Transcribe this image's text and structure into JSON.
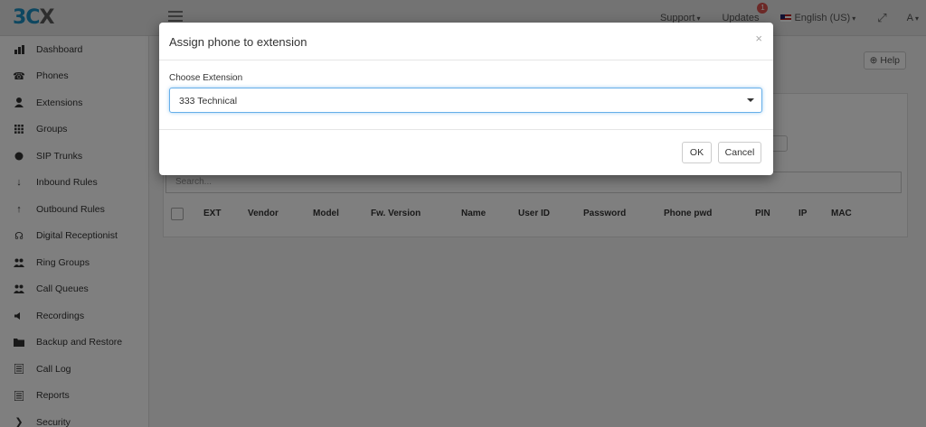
{
  "header": {
    "logo_text": "3C",
    "logo_x": "X",
    "support_label": "Support",
    "updates_label": "Updates",
    "updates_badge": "1",
    "language_label": "English (US)",
    "user_label": "A"
  },
  "sidebar": {
    "items": [
      {
        "label": "Dashboard",
        "icon": "bar-chart-icon"
      },
      {
        "label": "Phones",
        "icon": "phone-icon"
      },
      {
        "label": "Extensions",
        "icon": "user-icon"
      },
      {
        "label": "Groups",
        "icon": "grid-icon"
      },
      {
        "label": "SIP Trunks",
        "icon": "globe-icon"
      },
      {
        "label": "Inbound Rules",
        "icon": "arrow-down-icon"
      },
      {
        "label": "Outbound Rules",
        "icon": "arrow-up-icon"
      },
      {
        "label": "Digital Receptionist",
        "icon": "headset-icon"
      },
      {
        "label": "Ring Groups",
        "icon": "users-icon"
      },
      {
        "label": "Call Queues",
        "icon": "users-icon"
      },
      {
        "label": "Recordings",
        "icon": "volume-icon"
      },
      {
        "label": "Backup and Restore",
        "icon": "folder-icon"
      },
      {
        "label": "Call Log",
        "icon": "list-icon"
      },
      {
        "label": "Reports",
        "icon": "list-icon"
      },
      {
        "label": "Security",
        "icon": "chevron-right-icon"
      }
    ]
  },
  "main": {
    "help_label": "Help",
    "search_placeholder": "Search...",
    "columns": [
      "EXT",
      "Vendor",
      "Model",
      "Fw. Version",
      "Name",
      "User ID",
      "Password",
      "Phone pwd",
      "PIN",
      "IP",
      "MAC"
    ]
  },
  "modal": {
    "title": "Assign phone to extension",
    "close_glyph": "×",
    "field_label": "Choose Extension",
    "selected_value": "333 Technical",
    "ok_label": "OK",
    "cancel_label": "Cancel"
  }
}
